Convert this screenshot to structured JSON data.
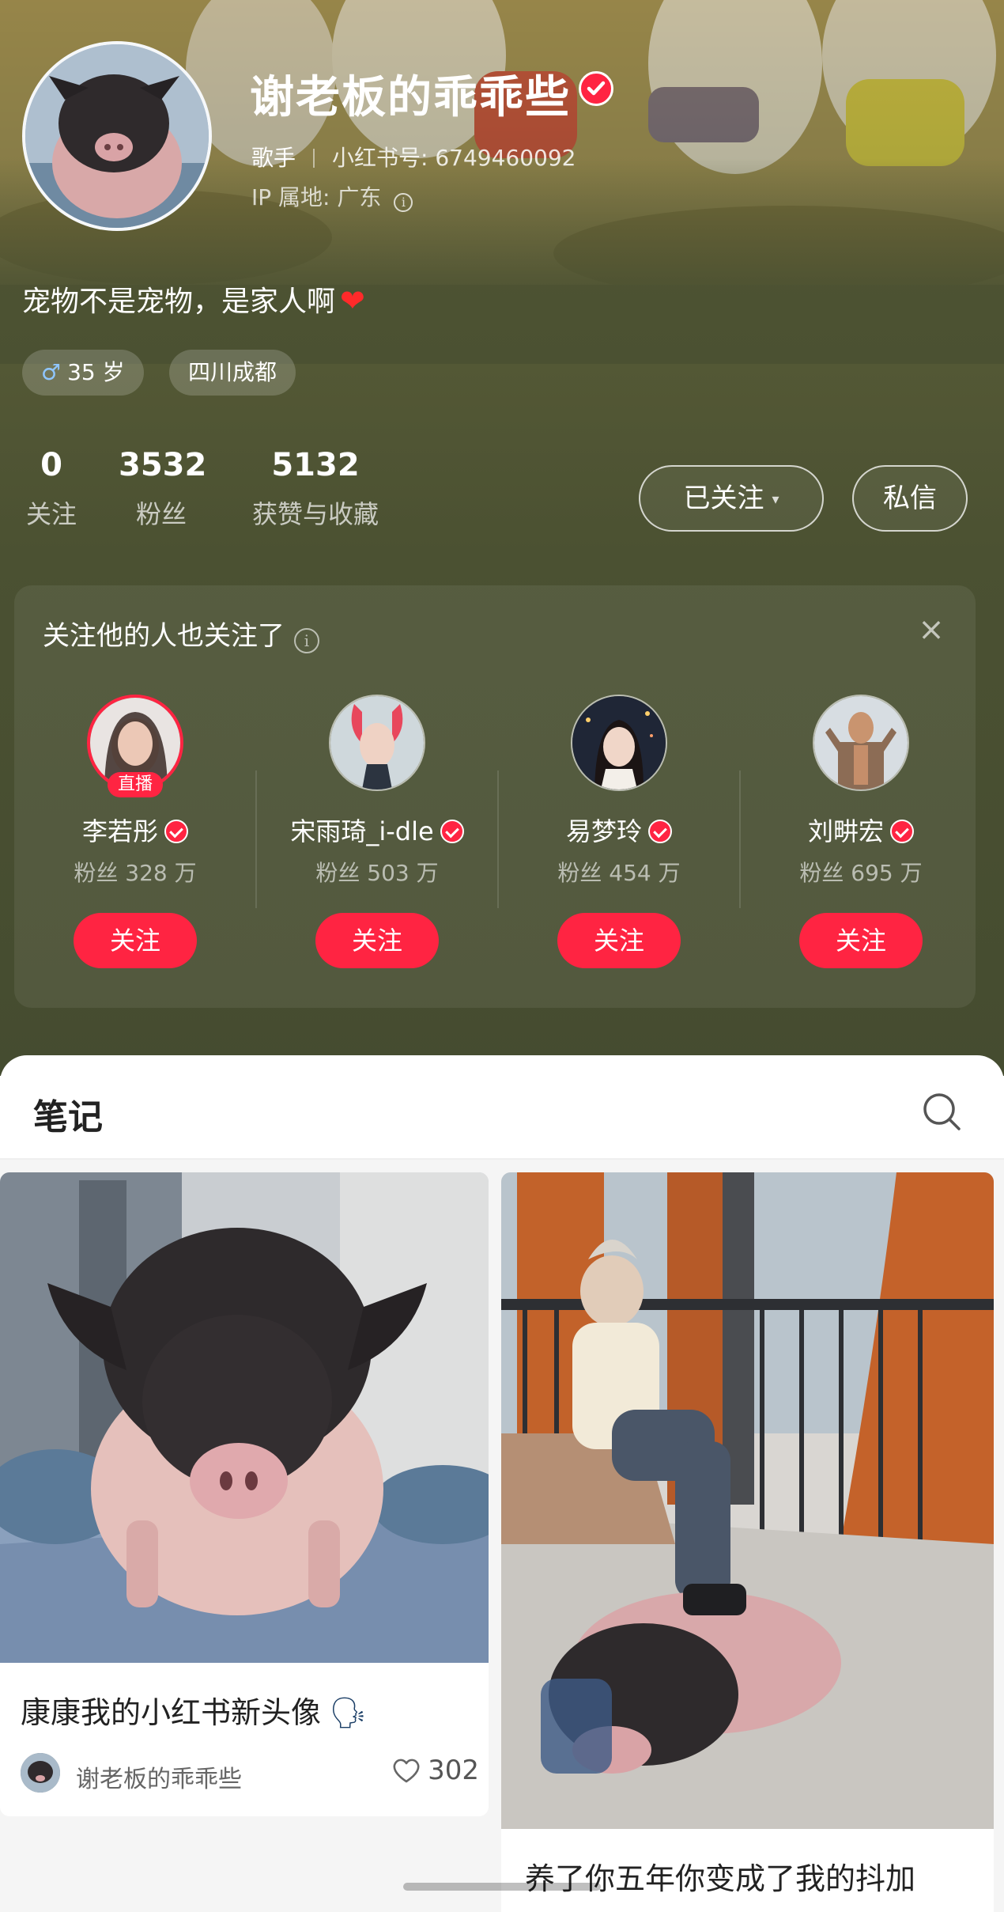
{
  "profile": {
    "name": "谢老板的乖乖些",
    "role": "歌手",
    "id_label": "小红书号: 6749460092",
    "ip_label": "IP 属地: 广东",
    "bio": "宠物不是宠物，是家人啊",
    "bio_emoji": "❤",
    "tags": {
      "age": "35 岁",
      "location": "四川成都",
      "gender_icon": "♂"
    },
    "stats": {
      "following": {
        "num": "0",
        "label": "关注"
      },
      "fans": {
        "num": "3532",
        "label": "粉丝"
      },
      "likes": {
        "num": "5132",
        "label": "获赞与收藏"
      }
    },
    "buttons": {
      "followed": "已关注",
      "followed_caret": "▾",
      "message": "私信"
    }
  },
  "recommend": {
    "title": "关注他的人也关注了",
    "info_icon": "i",
    "close_icon": "×",
    "users": [
      {
        "name": "李若彤",
        "fans": "粉丝 328 万",
        "live": "直播",
        "follow": "关注"
      },
      {
        "name": "宋雨琦_i-dle",
        "fans": "粉丝 503 万",
        "follow": "关注"
      },
      {
        "name": "易梦玲",
        "fans": "粉丝 454 万",
        "follow": "关注"
      },
      {
        "name": "刘畊宏",
        "fans": "粉丝 695 万",
        "follow": "关注"
      }
    ]
  },
  "notes": {
    "tab_title": "笔记",
    "items": [
      {
        "title": "康康我的小红书新头像",
        "emoji": "🗣",
        "author": "谢老板的乖乖些",
        "likes": "302"
      },
      {
        "title": "养了你五年你变成了我的抖加"
      }
    ]
  },
  "colors": {
    "accent": "#ff2442",
    "header_bg": "#4b5132"
  },
  "icons": [
    "verified-icon",
    "info-icon",
    "close-icon",
    "search-icon",
    "heart-outline-icon",
    "male-icon"
  ]
}
